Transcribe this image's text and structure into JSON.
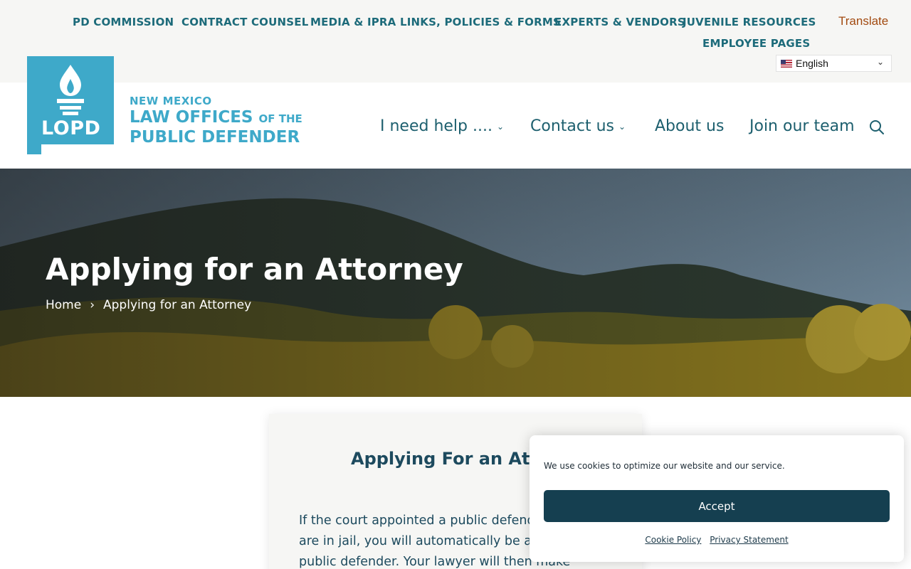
{
  "utility_nav": {
    "items": [
      "PD COMMISSION",
      "CONTRACT COUNSEL",
      "MEDIA & IPRA",
      "LINKS, POLICIES & FORMS",
      "EXPERTS & VENDORS",
      "JUVENILE RESOURCES",
      "EMPLOYEE PAGES"
    ]
  },
  "translate": {
    "label": "Translate",
    "selected_language": "English"
  },
  "brand": {
    "logo_text": "LOPD",
    "line1": "NEW MEXICO",
    "line2": "LAW OFFICES",
    "line2_small": "OF THE",
    "line3": "PUBLIC DEFENDER"
  },
  "main_nav": {
    "items": [
      "I need help ....",
      "Contact us",
      "About us",
      "Join our team"
    ]
  },
  "hero": {
    "title": "Applying for an Attorney",
    "breadcrumb": [
      "Home",
      "Applying for an Attorney"
    ],
    "breadcrumb_separator": "›"
  },
  "content": {
    "heading": "Applying For an Attorney",
    "paragraph": "If the court appointed a public defender or you are in jail, you will automatically be assigned a public defender. Your lawyer will then make"
  },
  "cookie_banner": {
    "message": "We use cookies to optimize our website and our service.",
    "accept_label": "Accept",
    "links": [
      "Cookie Policy",
      "Privacy Statement"
    ]
  },
  "colors": {
    "brand_teal": "#3ea9c9",
    "nav_text": "#1d5f6e",
    "accept_bg": "#153f50",
    "translate_text": "#a24a10"
  }
}
